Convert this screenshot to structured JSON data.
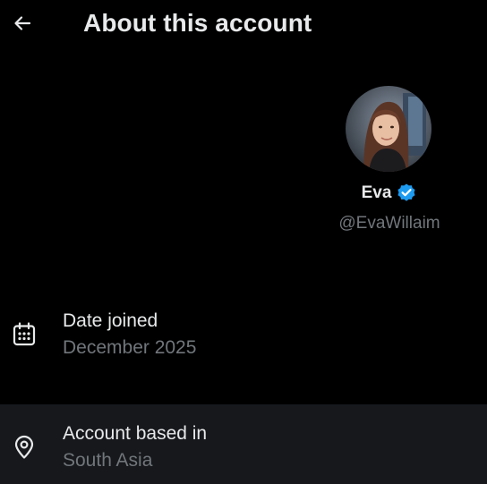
{
  "header": {
    "title": "About this account",
    "back_icon": "arrow-left-icon"
  },
  "profile": {
    "display_name": "Eva",
    "handle": "@EvaWillaim",
    "verified": true,
    "verified_color": "#1d9bf0"
  },
  "details": {
    "date_joined": {
      "label": "Date joined",
      "value": "December 2025",
      "icon": "calendar-icon"
    },
    "account_based": {
      "label": "Account based in",
      "value": "South Asia",
      "icon": "location-pin-icon"
    }
  },
  "colors": {
    "background": "#000000",
    "primary_text": "#e7e9ea",
    "secondary_text": "#71767b",
    "highlight_row": "#16181c"
  }
}
